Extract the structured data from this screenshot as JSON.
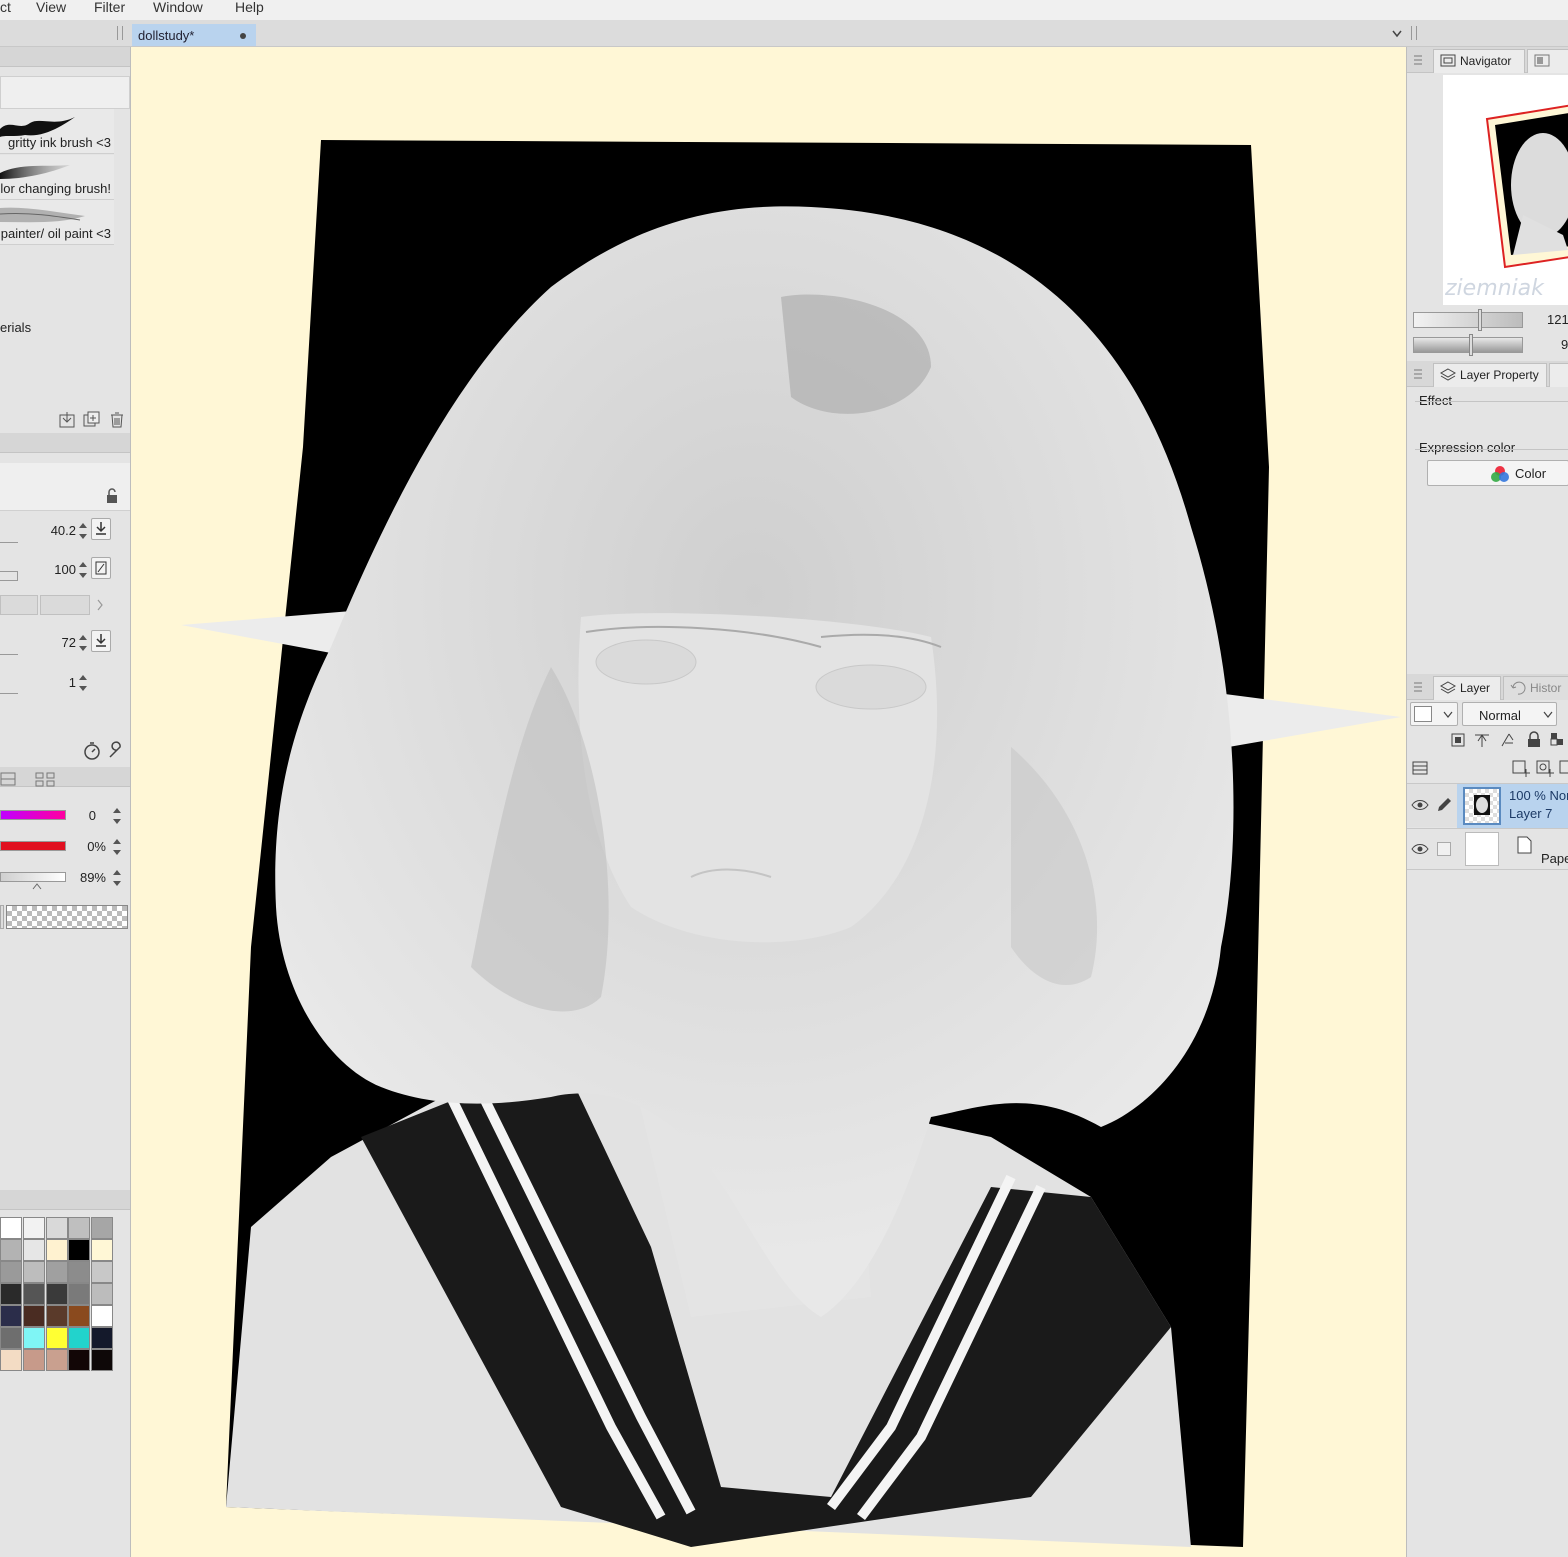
{
  "menu": {
    "items": [
      "ct",
      "View",
      "Filter",
      "Window",
      "Help"
    ]
  },
  "document_tab": {
    "title": "dollstudy*"
  },
  "brushes": [
    {
      "label": "gritty ink brush <3"
    },
    {
      "label": "lor changing brush!"
    },
    {
      "label": "painter/ oil paint <3"
    }
  ],
  "materials_label": "erials",
  "tool_property": {
    "brush_size": "40.2",
    "opacity": "100",
    "setting3": "72",
    "setting4": "1"
  },
  "color_sliders": {
    "hue": "0",
    "saturation": "0%",
    "value": "89%"
  },
  "palette": {
    "rows": [
      [
        "#ffffff",
        "#f2f2f2",
        "#d9d9d9",
        "#bfbfbf",
        "#a6a6a6"
      ],
      [
        "#b3b3b3",
        "#e6e6e6",
        "#fff2d0",
        "#000000",
        "#fff7d6"
      ],
      [
        "#9a9a9a",
        "#bdbdbd",
        "#a0a0a0",
        "#8c8c8c",
        "#c8c8c8"
      ],
      [
        "#2a2a2a",
        "#555555",
        "#3a3a3a",
        "#7a7a7a",
        "#bcbcbc"
      ],
      [
        "#2b2d4a",
        "#4a2c22",
        "#5a3a2a",
        "#8a4a1e",
        "#ffffff"
      ],
      [
        "#6e6e6e",
        "#7ff5f5",
        "#ffff33",
        "#22d3cc",
        "#14192b"
      ],
      [
        "#f3dcc4",
        "#c79a8a",
        "#c9a08f",
        "#120606",
        "#0e0808"
      ]
    ]
  },
  "navigator": {
    "tab_label": "Navigator",
    "zoom": "121",
    "rotation": "9"
  },
  "layer_property": {
    "tab_label": "Layer Property",
    "effect_label": "Effect",
    "expression_color_label": "Expression color",
    "color_button": "Color"
  },
  "layer_panel": {
    "tab_label": "Layer",
    "history_tab": "Histor",
    "blend_mode": "Normal",
    "layers": [
      {
        "info": "100 % Nor",
        "name": "Layer 7"
      },
      {
        "info": "",
        "name": "Pape"
      }
    ]
  },
  "colors": {
    "canvas_bg": "#fff7d6",
    "tab_active": "#b9d3ee",
    "layer_selected": "#b9d3ee"
  }
}
